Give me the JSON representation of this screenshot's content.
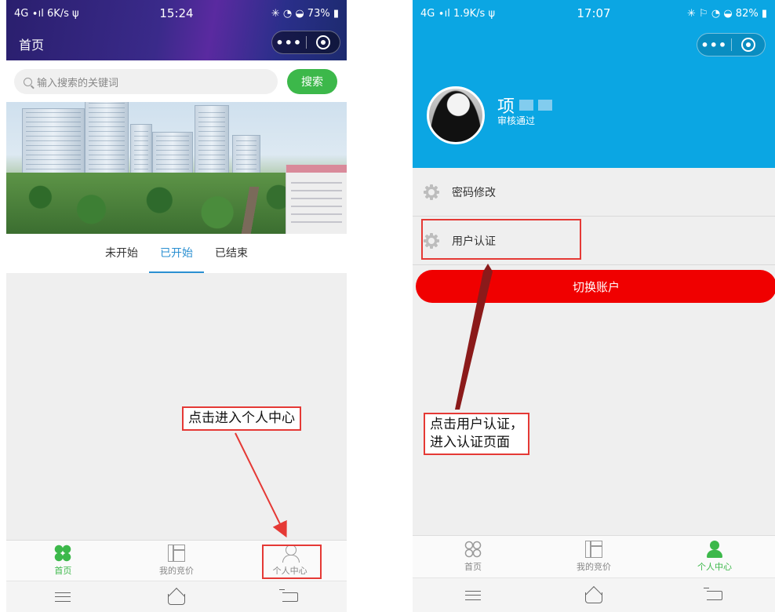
{
  "left_phone": {
    "status": {
      "left": "4G ∙ıl 6K/s ψ",
      "time": "15:24",
      "right": "✳ ◔ ◒ 73% ▮"
    },
    "title": "首页",
    "capsule": {
      "more": "•••"
    },
    "search": {
      "placeholder": "输入搜索的关键词",
      "button": "搜索"
    },
    "tabs": [
      "未开始",
      "已开始",
      "已结束"
    ],
    "tabbar": [
      "首页",
      "我的竞价",
      "个人中心"
    ]
  },
  "right_phone": {
    "status": {
      "left": "4G ∙ıl 1.9K/s ψ",
      "time": "17:07",
      "right": "✳ ⚐ ◔ ◒ 82% ▮"
    },
    "capsule": {
      "more": "•••"
    },
    "user": {
      "name": "项",
      "status": "审核通过"
    },
    "menu": [
      "密码修改",
      "用户认证"
    ],
    "switch_account": "切换账户",
    "tabbar": [
      "首页",
      "我的竞价",
      "个人中心"
    ]
  },
  "annotations": {
    "left": "点击进入个人中心",
    "right_line1": "点击用户认证，",
    "right_line2": "进入认证页面"
  },
  "colors": {
    "accent_green": "#3cb84a",
    "tab_blue": "#2a8fd1",
    "header_blue": "#0ba6e3",
    "switch_red": "#f00000",
    "annotation_red": "#e53935"
  }
}
